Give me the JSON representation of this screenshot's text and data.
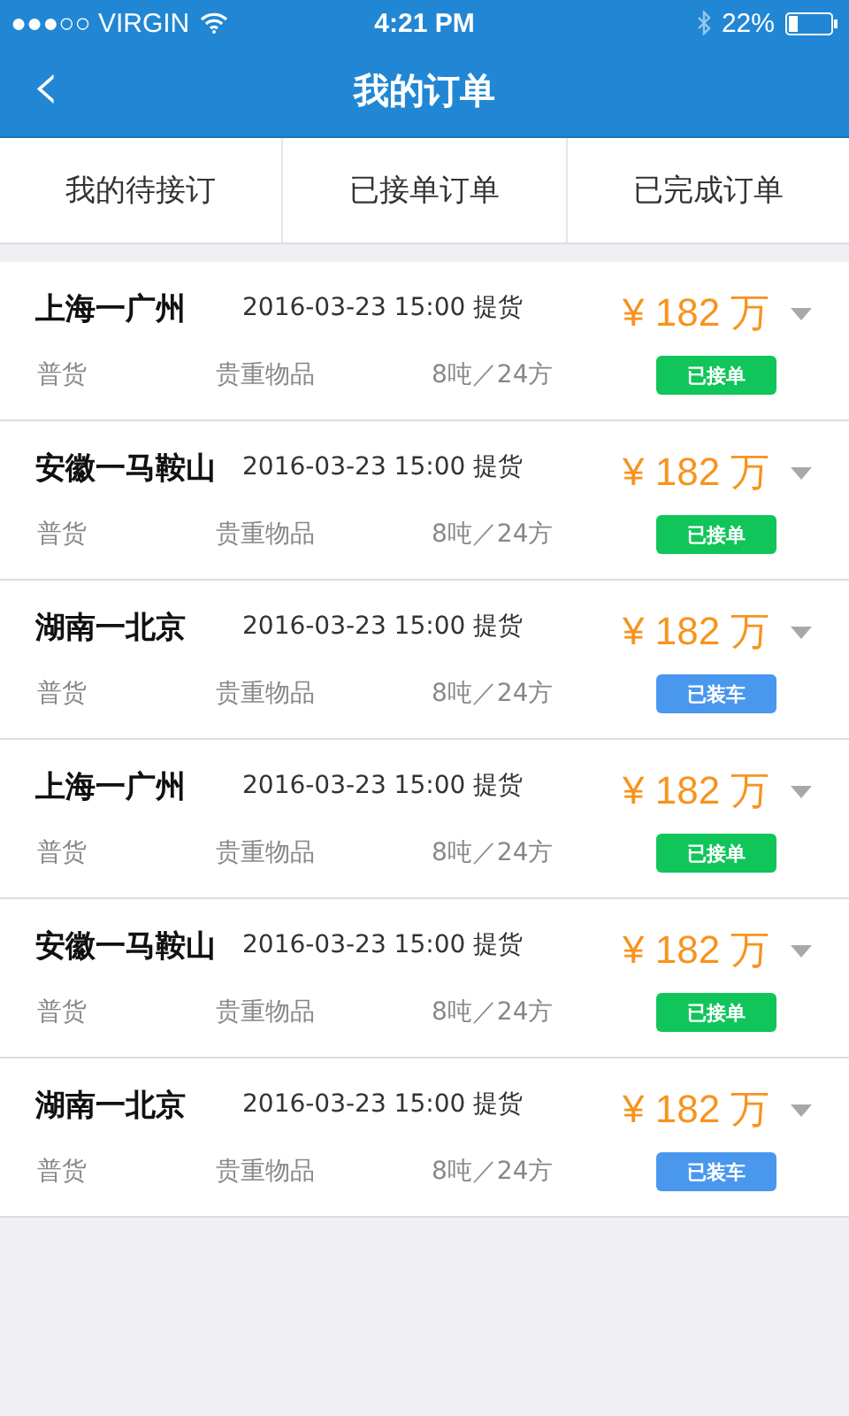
{
  "status_bar": {
    "carrier": "●●●○○ VIRGIN",
    "time": "4:21 PM",
    "battery": "22%"
  },
  "nav": {
    "back": "‹",
    "title": "我的订单"
  },
  "tabs": [
    "我的待接订",
    "已接单订单",
    "已完成订单"
  ],
  "orders": [
    {
      "route": "上海一广州",
      "pickup": "2016-03-23  15:00 提货",
      "price": "¥ 182 万",
      "type": "普货",
      "goods": "贵重物品",
      "load": "8吨／24方",
      "status": "已接单",
      "color": "#10c55a"
    },
    {
      "route": "安徽一马鞍山",
      "pickup": "2016-03-23  15:00 提货",
      "price": "¥ 182 万",
      "type": "普货",
      "goods": "贵重物品",
      "load": "8吨／24方",
      "status": "已接单",
      "color": "#10c55a"
    },
    {
      "route": "湖南一北京",
      "pickup": "2016-03-23  15:00 提货",
      "price": "¥ 182 万",
      "type": "普货",
      "goods": "贵重物品",
      "load": "8吨／24方",
      "status": "已装车",
      "color": "#4a97ee"
    },
    {
      "route": "上海一广州",
      "pickup": "2016-03-23  15:00 提货",
      "price": "¥ 182 万",
      "type": "普货",
      "goods": "贵重物品",
      "load": "8吨／24方",
      "status": "已接单",
      "color": "#10c55a"
    },
    {
      "route": "安徽一马鞍山",
      "pickup": "2016-03-23  15:00 提货",
      "price": "¥ 182 万",
      "type": "普货",
      "goods": "贵重物品",
      "load": "8吨／24方",
      "status": "已接单",
      "color": "#10c55a"
    },
    {
      "route": "湖南一北京",
      "pickup": "2016-03-23  15:00 提货",
      "price": "¥ 182 万",
      "type": "普货",
      "goods": "贵重物品",
      "load": "8吨／24方",
      "status": "已装车",
      "color": "#4a97ee"
    }
  ]
}
